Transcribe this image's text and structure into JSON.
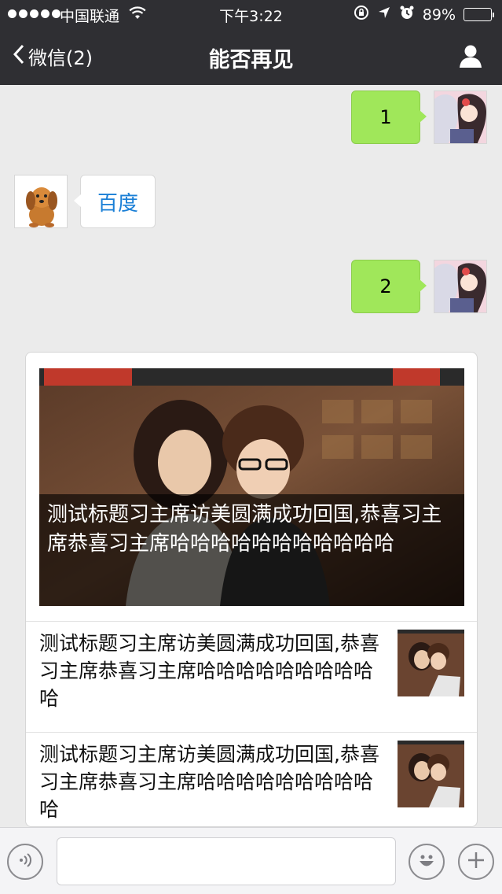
{
  "status_bar": {
    "carrier": "中国联通",
    "time": "下午3:22",
    "battery_percent": "89%",
    "battery_level": 0.89,
    "icons": [
      "signal-dots-icon",
      "wifi-icon",
      "rotation-lock-icon",
      "location-arrow-icon",
      "alarm-icon",
      "battery-icon"
    ]
  },
  "nav": {
    "back_label": "微信(2)",
    "title": "能否再见",
    "icons": [
      "chevron-left-icon",
      "profile-icon"
    ]
  },
  "messages": [
    {
      "direction": "out",
      "text": "1"
    },
    {
      "direction": "in",
      "text": "百度"
    },
    {
      "direction": "out",
      "text": "2"
    }
  ],
  "news_card": {
    "hero": {
      "caption": "测试标题习主席访美圆满成功回国,恭喜习主席恭喜习主席哈哈哈哈哈哈哈哈哈哈哈"
    },
    "items": [
      {
        "title": "测试标题习主席访美圆满成功回国,恭喜习主席恭喜习主席哈哈哈哈哈哈哈哈哈哈"
      },
      {
        "title": "测试标题习主席访美圆满成功回国,恭喜习主席恭喜习主席哈哈哈哈哈哈哈哈哈哈"
      }
    ]
  },
  "input_bar": {
    "icons": [
      "voice-icon",
      "emoji-icon",
      "plus-icon"
    ]
  },
  "colors": {
    "nav_bg": "#2f2f33",
    "chat_bg": "#ebebeb",
    "outgoing_bubble": "#a0e75a",
    "incoming_text": "#1a7fd6"
  }
}
